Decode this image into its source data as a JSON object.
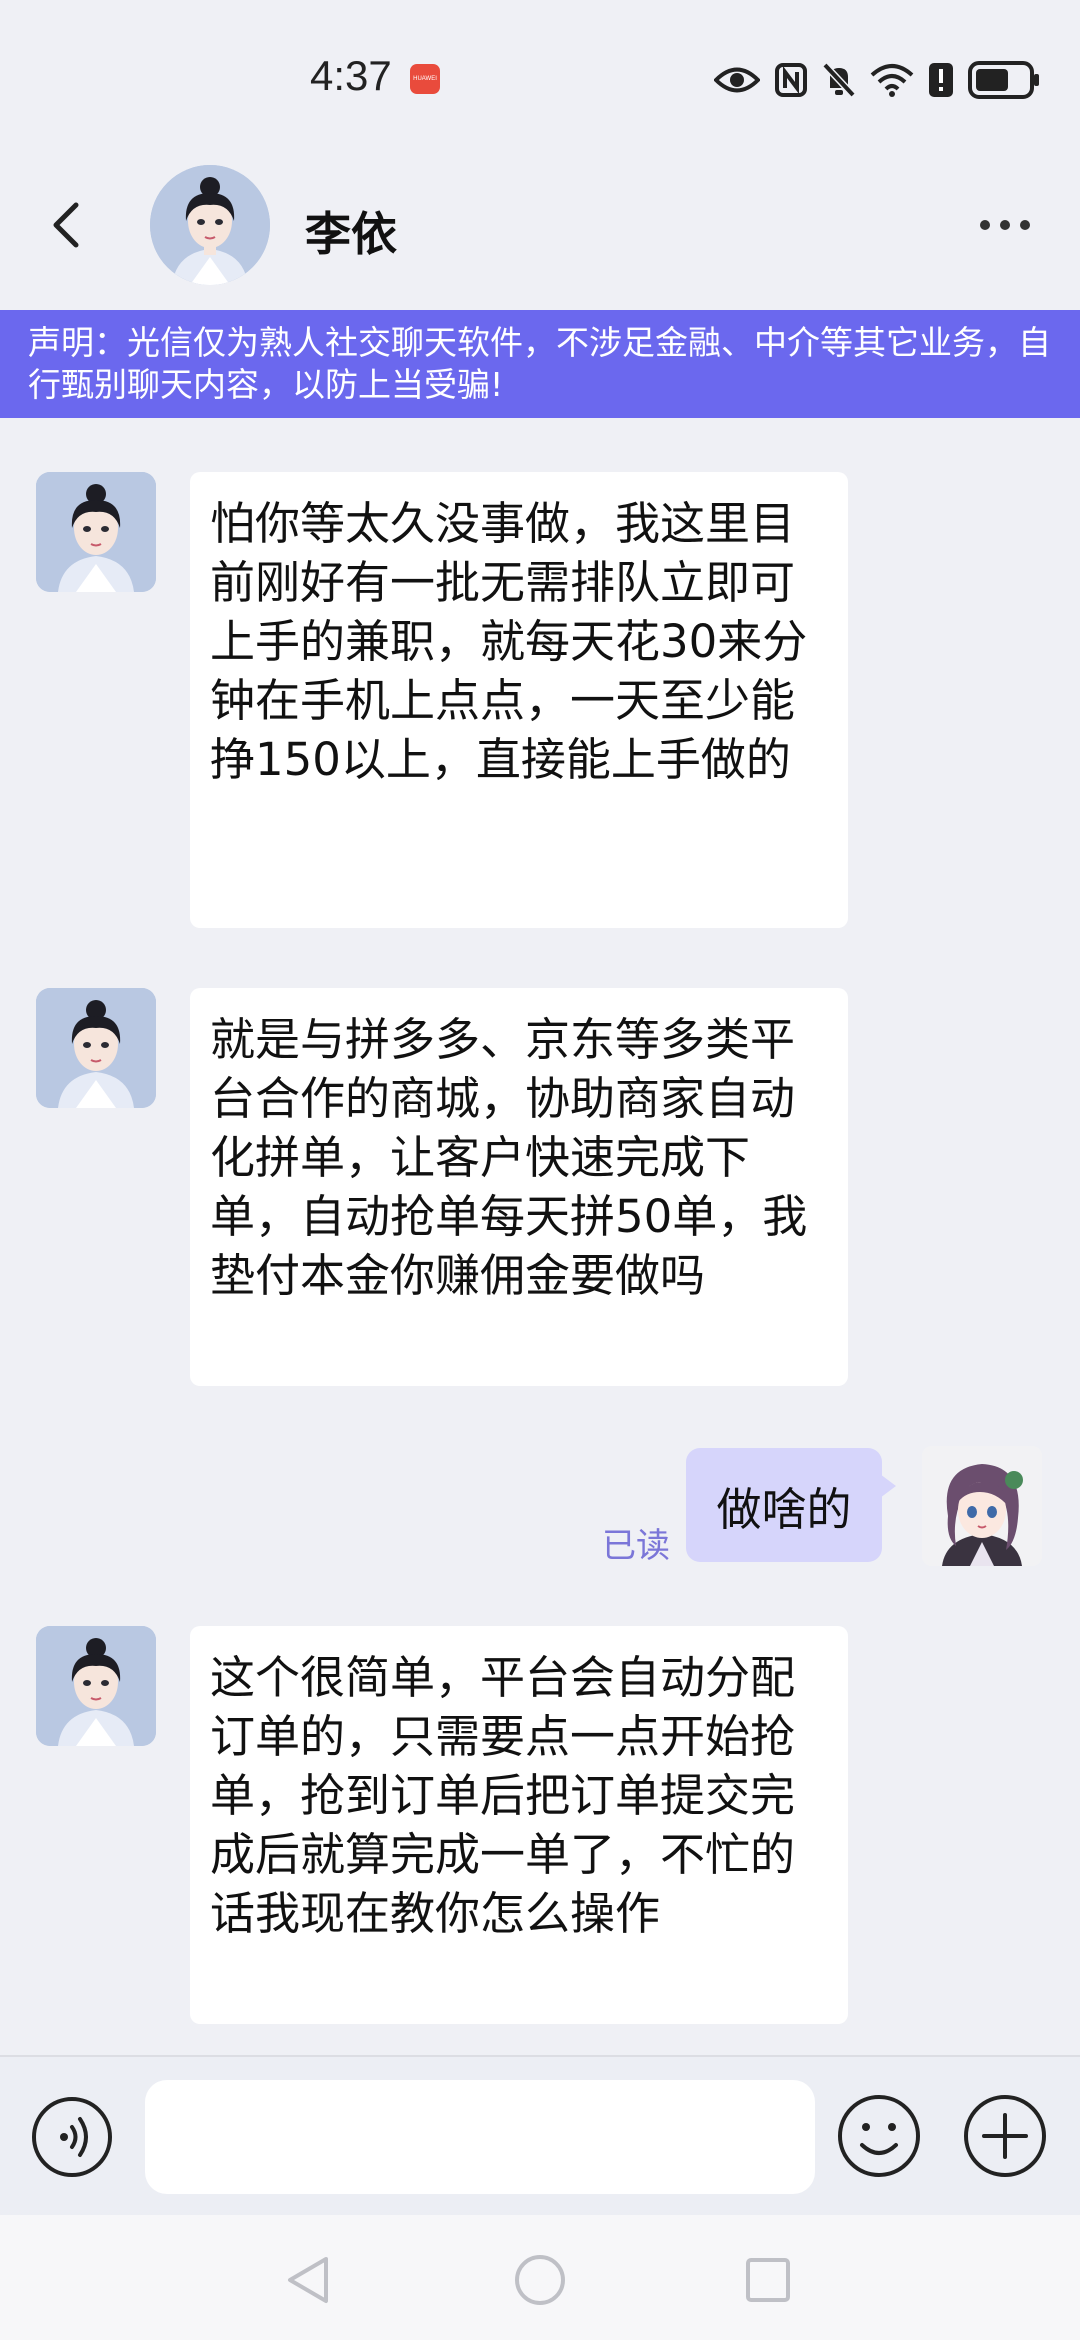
{
  "status_bar": {
    "time": "4:37",
    "badge_text": "HUAWEI",
    "icons": [
      "eye-icon",
      "nfc-icon",
      "mute-icon",
      "wifi-icon",
      "alert-icon",
      "battery-icon"
    ]
  },
  "header": {
    "contact_name": "李依",
    "back_icon": "chevron-left-icon",
    "more_icon": "more-dots-icon"
  },
  "notice": {
    "text": "声明：光信仅为熟人社交聊天软件，不涉足金融、中介等其它业务，自行甄别聊天内容，以防上当受骗!"
  },
  "messages": [
    {
      "direction": "incoming",
      "text": "怕你等太久没事做，我这里目前刚好有一批无需排队立即可上手的兼职，就每天花30来分钟在手机上点点，一天至少能挣150以上，直接能上手做的"
    },
    {
      "direction": "incoming",
      "text": "就是与拼多多、京东等多类平台合作的商城，协助商家自动化拼单，让客户快速完成下单，自动抢单每天拼50单，我垫付本金你赚佣金要做吗"
    },
    {
      "direction": "outgoing",
      "text": "做啥的",
      "status": "已读"
    },
    {
      "direction": "incoming",
      "text": "这个很简单，平台会自动分配订单的，只需要点一点开始抢单，抢到订单后把订单提交完成后就算完成一单了，不忙的话我现在教你怎么操作"
    }
  ],
  "input_bar": {
    "voice_icon": "voice-icon",
    "input_value": "",
    "emoji_icon": "emoji-icon",
    "plus_icon": "plus-icon"
  },
  "nav_bar": {
    "icons": [
      "nav-back-icon",
      "nav-home-icon",
      "nav-recents-icon"
    ]
  },
  "colors": {
    "notice_bg": "#6b68ee",
    "outgoing_bubble": "#d6d5fb",
    "read_status": "#7b76d8",
    "page_bg": "#eff0f5"
  }
}
